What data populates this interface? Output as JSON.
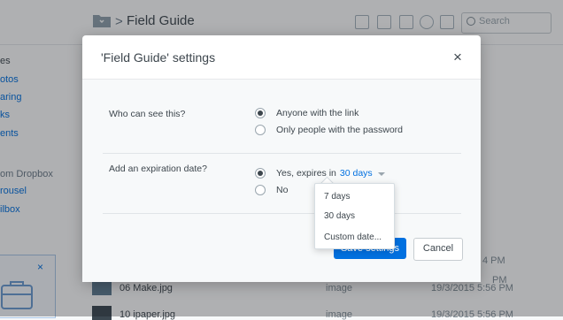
{
  "background": {
    "breadcrumb_sep": ">",
    "folder_title": "Field Guide",
    "search_placeholder": "Search",
    "sidebar_items": [
      "es",
      "otos",
      "aring",
      "ks",
      "ents"
    ],
    "sidebar_section": "om Dropbox",
    "sidebar_more": [
      "rousel",
      "ilbox"
    ],
    "promo_close": "×",
    "files": [
      {
        "date": "4 PM"
      },
      {
        "date": "PM"
      },
      {
        "name": "06 Make.jpg",
        "kind": "image",
        "date": "19/3/2015 5:56 PM"
      },
      {
        "name": "10 ipaper.jpg",
        "kind": "image",
        "date": "19/3/2015 5:56 PM"
      }
    ]
  },
  "modal": {
    "title": "'Field Guide' settings",
    "close_label": "×",
    "visibility": {
      "question": "Who can see this?",
      "options": [
        "Anyone with the link",
        "Only people with the password"
      ],
      "selected": 0
    },
    "expiration": {
      "question": "Add an expiration date?",
      "yes_label": "Yes, expires in",
      "duration_value": "30 days",
      "no_label": "No",
      "selected": "yes"
    },
    "dropdown_options": [
      "7 days",
      "30 days",
      "Custom date..."
    ],
    "buttons": {
      "save": "Save settings",
      "cancel": "Cancel"
    }
  },
  "colors": {
    "accent": "#0070e0",
    "text": "#3d464d",
    "muted": "#7f8c95"
  }
}
